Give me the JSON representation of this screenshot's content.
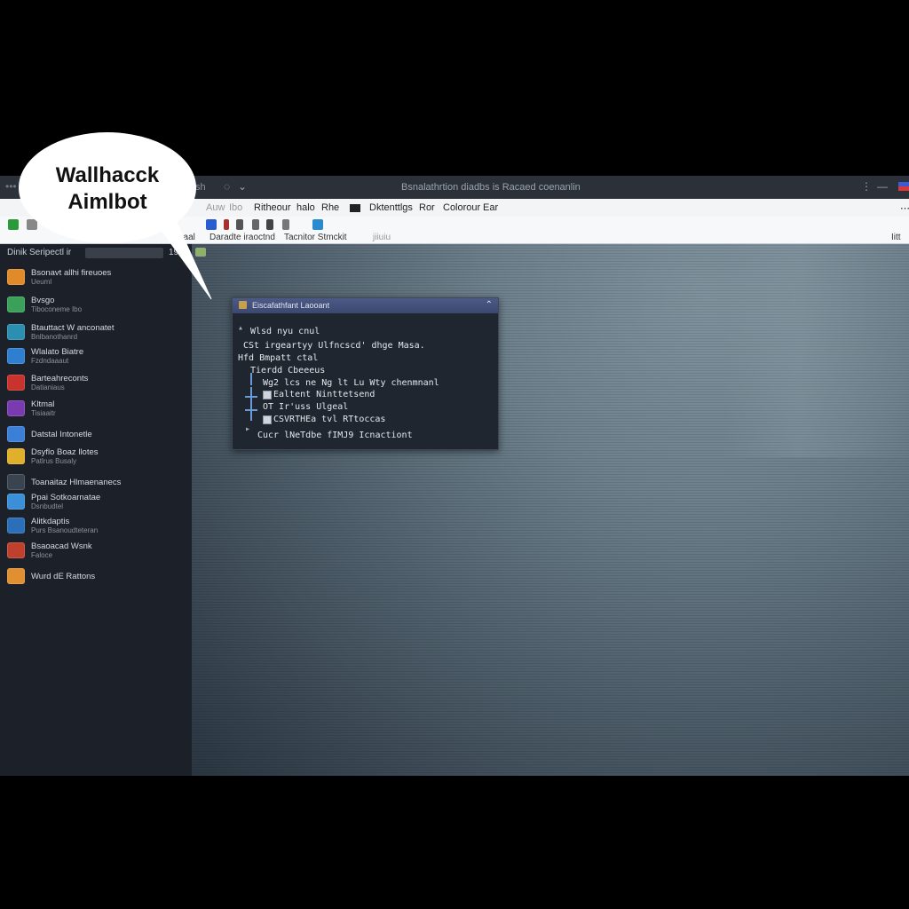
{
  "titlebar": {
    "title": "Bsnalathrtion diadbs is Racaed coenanlin",
    "left_text": "sh",
    "minimize": "⋮",
    "close": "—"
  },
  "menubar": {
    "items": [
      "Auw",
      "Ibo",
      "Ritheour",
      "halo",
      "Rhe",
      "Dktenttlgs",
      "Ror",
      "Colorour",
      "Ear"
    ]
  },
  "toolbar": {
    "labels": [
      "Jaaal",
      "Daradte iraoctnd",
      "Tacnitor Stmckit",
      "jiiuiu"
    ],
    "right_label": "Iitt"
  },
  "sidebar": {
    "header": "Dinik Seripectl ir",
    "count": "190",
    "items": [
      {
        "line1": "Bsonavt allhi fireuoes",
        "line2": "Ueuml",
        "icon": "orange-app-icon",
        "color": "#e08a2a"
      },
      {
        "line1": "Bvsgo",
        "line2": "Tiboconeme Ibo",
        "icon": "green-app-icon",
        "color": "#3aa05a"
      },
      {
        "line1": "Btauttact W anconatet",
        "line2": "Bnlbanothanrd",
        "icon": "blue-green-app-icon",
        "color": "#2a8fb0"
      },
      {
        "line1": "Wlalato Biatre",
        "line2": "Fzdndaaaut",
        "icon": "blue-app-icon",
        "color": "#2f7fd0"
      },
      {
        "line1": "Barteahreconts",
        "line2": "Datianiaus",
        "icon": "red-app-icon",
        "color": "#c8332e"
      },
      {
        "line1": "Kltmal",
        "line2": "Tisiaaitr",
        "icon": "purple-app-icon",
        "color": "#7a3ab0"
      },
      {
        "line1": "Datstal Intonetle",
        "line2": "",
        "icon": "blue-folder-icon",
        "color": "#3b7fd6"
      },
      {
        "line1": "Dsyflo Boaz llotes",
        "line2": "Patlrus Busaly",
        "icon": "yellow-folder-icon",
        "color": "#e0b02a"
      },
      {
        "line1": "Toanaitaz Hlmaenanecs",
        "line2": "",
        "icon": "dark-app-icon",
        "color": "#3a4350"
      },
      {
        "line1": "Ppai Sotkoarnatae",
        "line2": "Dsnbudtel",
        "icon": "cloud-icon",
        "color": "#3b8fd8"
      },
      {
        "line1": "Alitkdaptis",
        "line2": "Purs Bsanoudteteran",
        "icon": "globe-icon",
        "color": "#2a6fb8"
      },
      {
        "line1": "Bsaoacad Wsnk",
        "line2": "Faloce",
        "icon": "red-tools-icon",
        "color": "#c0402e"
      },
      {
        "line1": "Wurd dE Rattons",
        "line2": "",
        "icon": "orange-folder-icon",
        "color": "#e09030"
      }
    ]
  },
  "dialog": {
    "title": "Eiscafathfant Laooant",
    "lines": [
      "Wlsd nyu cnul",
      "CSt irgeartyy Ulfncscd' dhge Masa.",
      "Hfd Bmpatt ctal",
      "Tierdd Cbeeeus",
      "Wg2 lcs ne Ng lt Lu Wty chenmnanl",
      "Ealtent Ninttetsend",
      "OT Ir'uss   Ulgeal",
      "CSVRTHEa tvl RTtoccas",
      "Cucr lNeTdbe   fIMJ9   Icnactiont"
    ]
  },
  "speech_bubble": {
    "line1": "Wallhacck",
    "line2": "Aimlbot"
  }
}
